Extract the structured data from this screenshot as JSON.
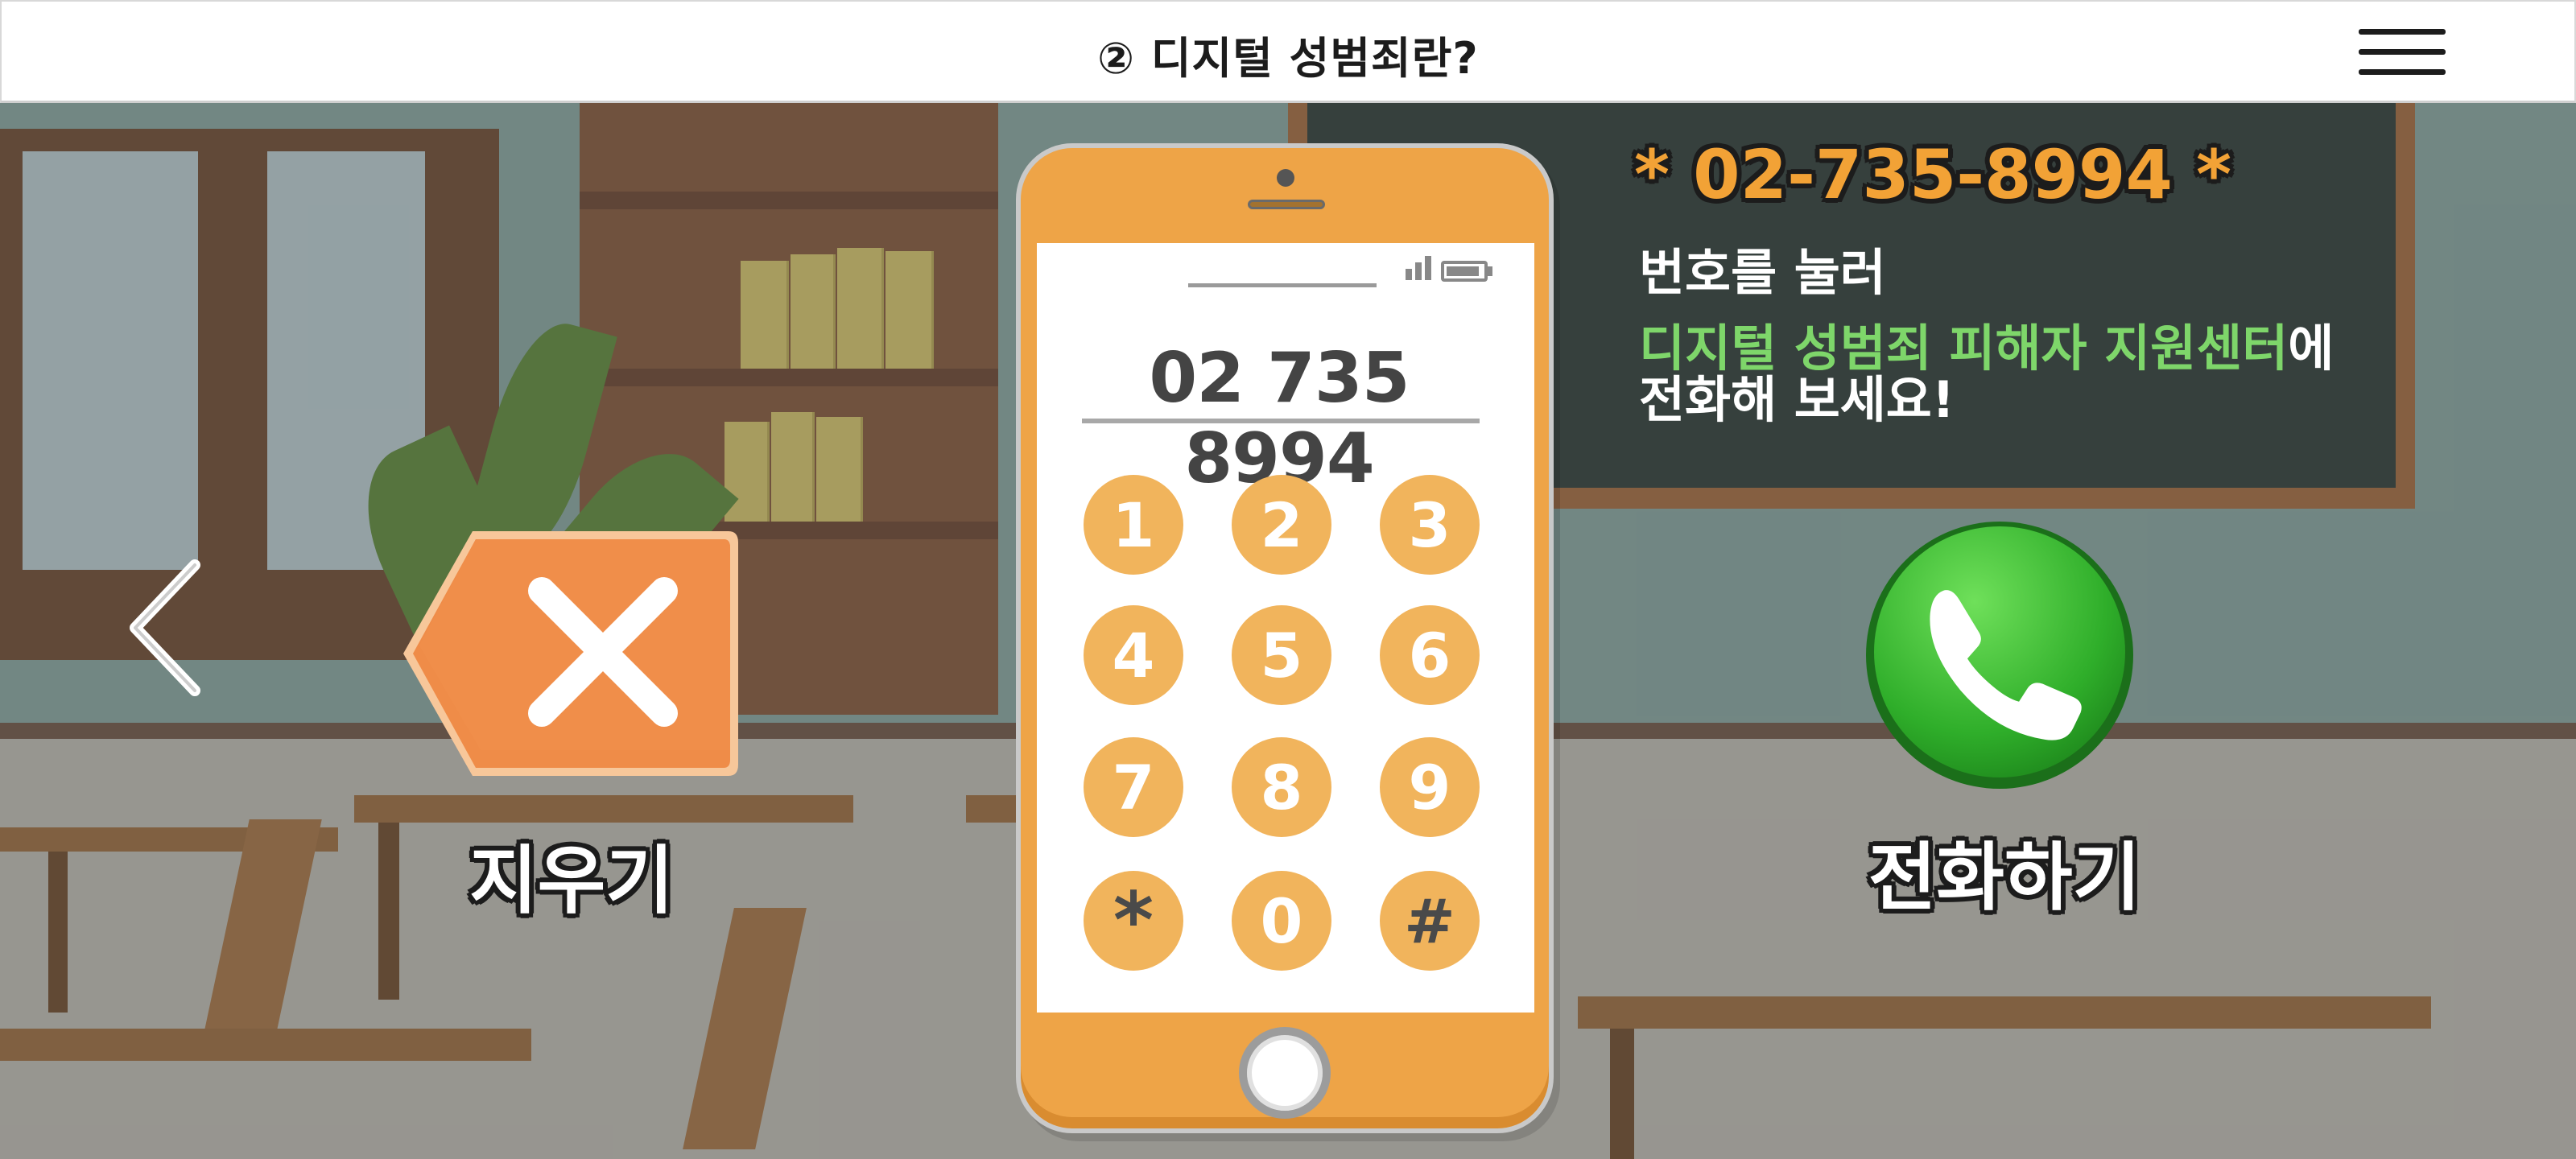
{
  "header": {
    "title": "② 디지털 성범죄란?",
    "menu_icon": "hamburger-menu-icon"
  },
  "navigation": {
    "back_icon": "chevron-left-icon"
  },
  "erase": {
    "label": "지우기",
    "icon": "backspace-x-icon",
    "color": "#ef8c48"
  },
  "phone": {
    "display_number": "02 735 8994",
    "keypad": [
      "1",
      "2",
      "3",
      "4",
      "5",
      "6",
      "7",
      "8",
      "9",
      "*",
      "0",
      "#"
    ],
    "color": "#eea447",
    "key_color": "#f1b45c"
  },
  "instructions": {
    "hotline": "* 02-735-8994 *",
    "line1": "번호를 눌러",
    "line2_highlight": "디지털 성범죄 피해자 지원센터",
    "line2_suffix": "에",
    "line3": "전화해 보세요!",
    "highlight_color": "#7ed66a"
  },
  "call": {
    "label": "전화하기",
    "icon": "phone-handset-icon",
    "color": "#2fae2a"
  }
}
